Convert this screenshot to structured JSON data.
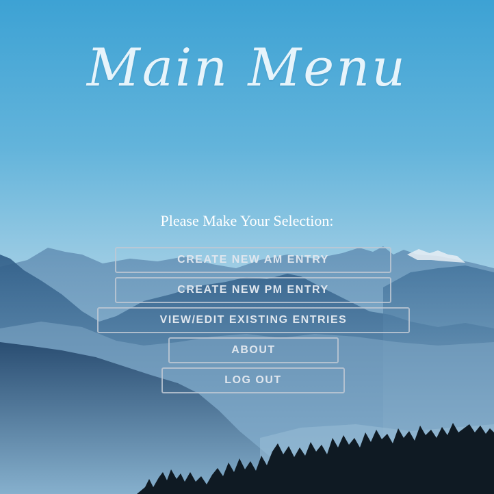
{
  "header": {
    "title": "Main Menu"
  },
  "prompt": "Please Make Your Selection:",
  "menu": {
    "items": [
      {
        "label": "CREATE NEW AM ENTRY"
      },
      {
        "label": "CREATE NEW PM ENTRY"
      },
      {
        "label": "VIEW/EDIT EXISTING ENTRIES"
      },
      {
        "label": "ABOUT"
      },
      {
        "label": "LOG OUT"
      }
    ]
  },
  "colors": {
    "sky_top": "#3fa3d4",
    "sky_bottom": "#a7d1e6",
    "button_border": "#bec8d4",
    "button_text": "#dfe6ee"
  }
}
